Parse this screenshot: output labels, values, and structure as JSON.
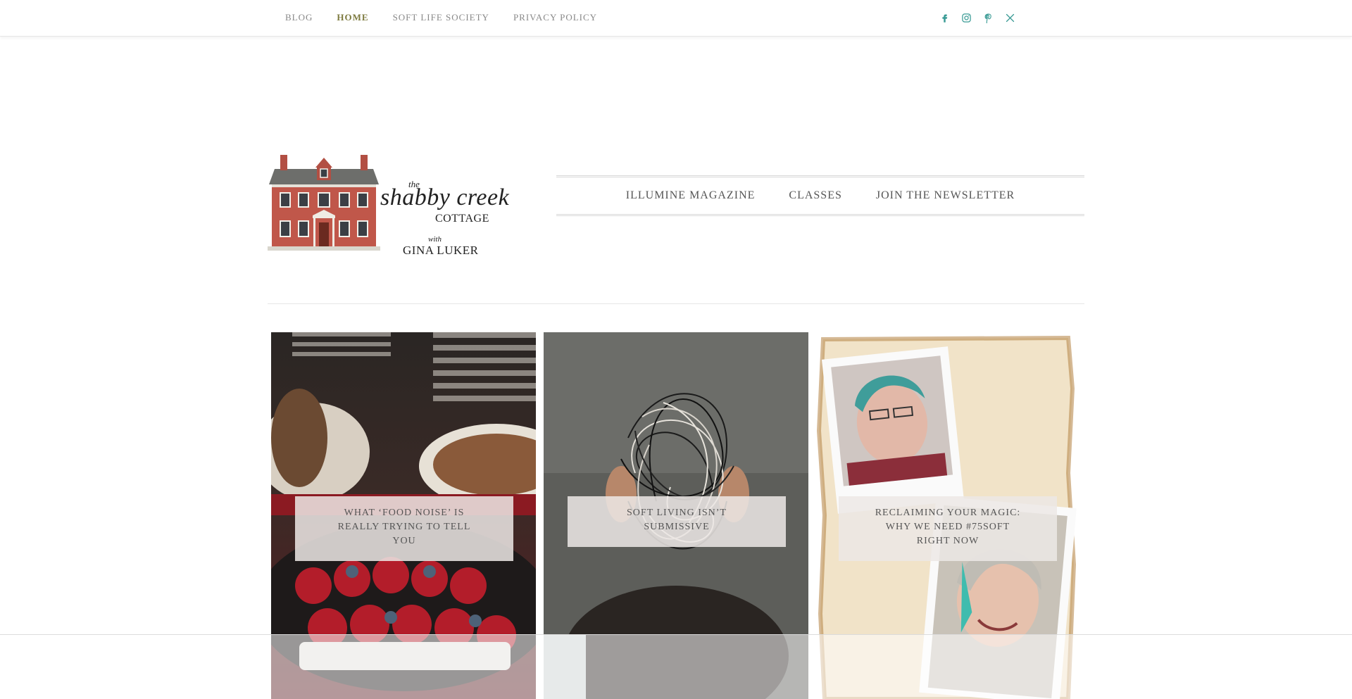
{
  "top_nav": {
    "items": [
      {
        "label": "BLOG",
        "active": false
      },
      {
        "label": "HOME",
        "active": true
      },
      {
        "label": "SOFT LIFE SOCIETY",
        "active": false
      },
      {
        "label": "PRIVACY POLICY",
        "active": false
      }
    ]
  },
  "social": {
    "icons": [
      "facebook-icon",
      "instagram-icon",
      "pinterest-icon",
      "x-twitter-icon"
    ],
    "color": "#3a9b95"
  },
  "logo": {
    "the": "the",
    "shabby_creek": "shabby creek",
    "cottage": "COTTAGE",
    "with": "with",
    "gina": "GINA LUKER"
  },
  "main_nav": {
    "items": [
      "ILLUMINE MAGAZINE",
      "CLASSES",
      "JOIN THE NEWSLETTER"
    ]
  },
  "posts": [
    {
      "title": "WHAT ‘FOOD NOISE’ IS REALLY TRYING TO TELL YOU"
    },
    {
      "title": "SOFT LIVING ISN’T SUBMISSIVE"
    },
    {
      "title": "RECLAIMING YOUR MAGIC: WHY WE NEED #75SOFT RIGHT NOW"
    }
  ],
  "colors": {
    "accent": "#7d7a3f",
    "nav_text": "#888888",
    "brick": "#c0574a"
  }
}
